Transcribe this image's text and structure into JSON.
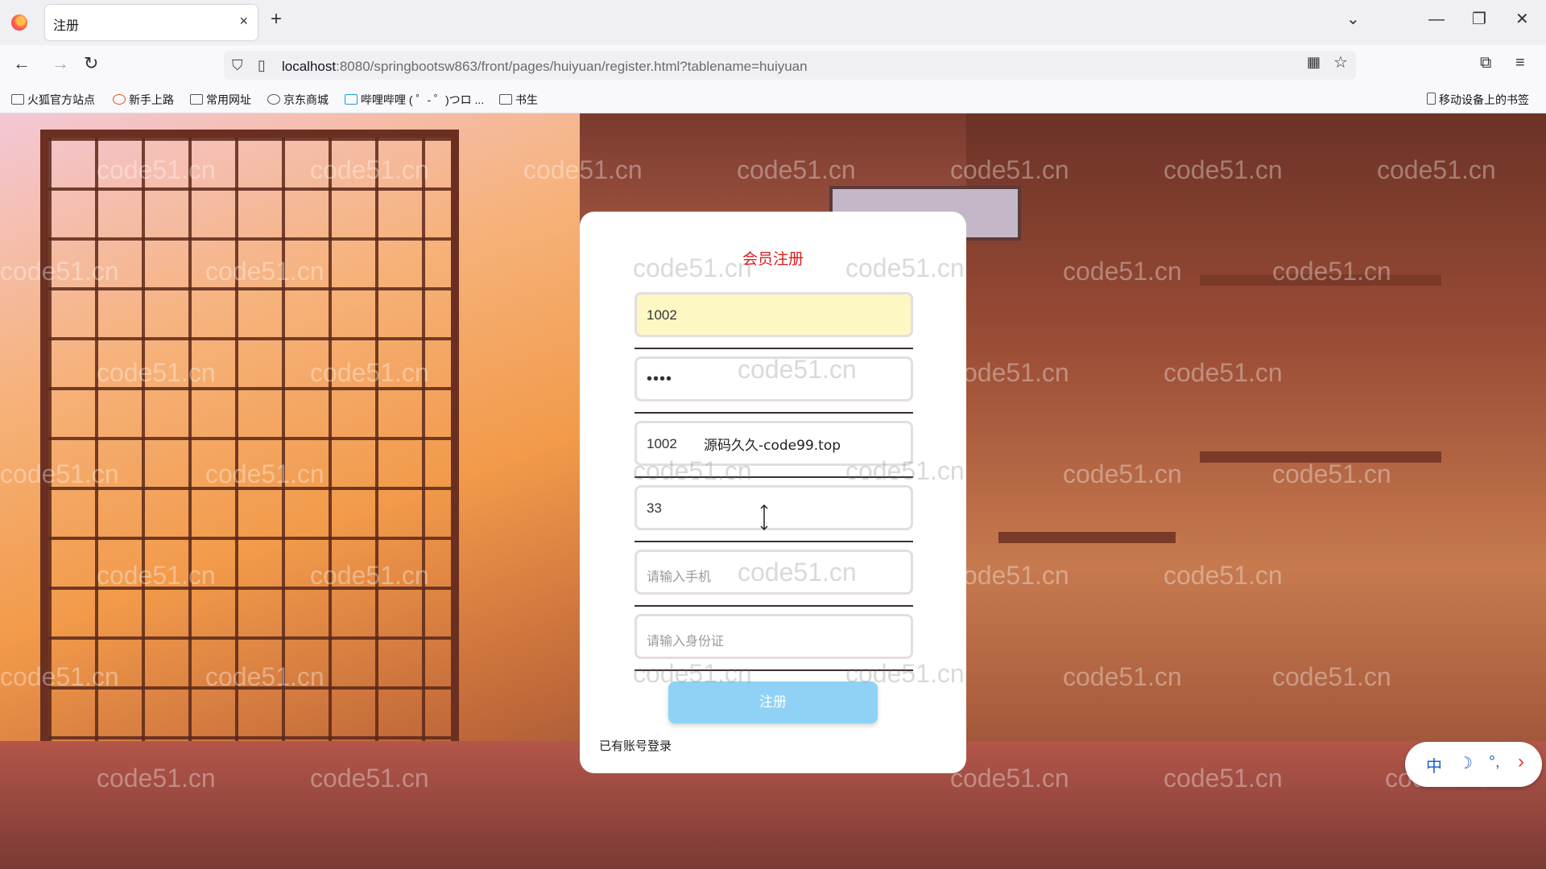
{
  "browser": {
    "tab_title": "注册",
    "tab_close": "×",
    "new_tab": "+",
    "url_host": "localhost",
    "url_rest": ":8080/springbootsw863/front/pages/huiyuan/register.html?tablename=huiyuan",
    "bookmarks": [
      "火狐官方站点",
      "新手上路",
      "常用网址",
      "京东商城",
      "哔哩哔哩 ( ゜- ゜)つロ ...",
      "书生"
    ],
    "mobile_bookmarks": "移动设备上的书签"
  },
  "form": {
    "title": "会员注册",
    "account_value": "1002",
    "password_value": "••••",
    "name_value": "1002",
    "age_value": "33",
    "phone_placeholder": "请输入手机",
    "idcard_placeholder": "请输入身份证",
    "submit_label": "注册",
    "login_link": "已有账号登录"
  },
  "overlay": {
    "text": "源码久久-code99.top"
  },
  "watermark": "code51.cn",
  "ime": {
    "lang": "中",
    "moon": "☽",
    "punct": "°,",
    "arrow": "›"
  },
  "colors": {
    "title_red": "#d81e1e",
    "button_blue": "#8fd2f6",
    "autofill_yellow": "#fdf7c3"
  }
}
